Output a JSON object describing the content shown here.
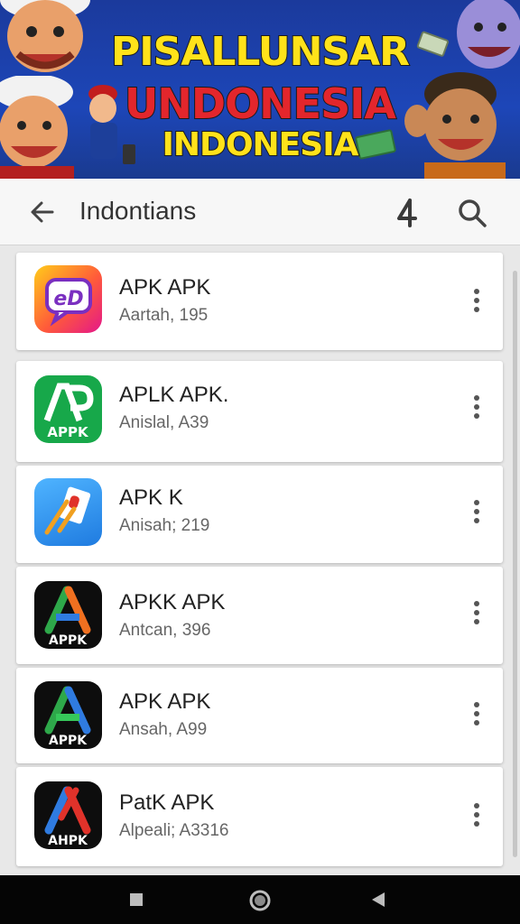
{
  "banner": {
    "line1": "PISALLUNSAR",
    "line2": "UNDONESIA",
    "line3": "INDONESIA"
  },
  "appbar": {
    "title": "Indontians",
    "back_icon": "arrow-left-icon",
    "filter_icon": "filter-icon",
    "search_icon": "search-icon"
  },
  "apps": [
    {
      "name": "APK APK",
      "sub": "Aartah, 195",
      "icon": "chat-bubble-icon"
    },
    {
      "name": "APLK APK.",
      "sub": "Anislal, A39",
      "icon": "apk-green-icon"
    },
    {
      "name": "APK K",
      "sub": "Anisah; 219",
      "icon": "apk-blue-icon"
    },
    {
      "name": "APKK APK",
      "sub": "Antcan, 396",
      "icon": "apk-rainbow-icon"
    },
    {
      "name": "APK APK",
      "sub": "Ansah, A99",
      "icon": "apk-green-blue-icon"
    },
    {
      "name": "PatK APK",
      "sub": "Alpeali; A3316",
      "icon": "apk-red-blue-icon"
    }
  ],
  "colors": {
    "banner_blue": "#1d46b8",
    "banner_yellow": "#ffe21a",
    "banner_red": "#e3262c"
  }
}
